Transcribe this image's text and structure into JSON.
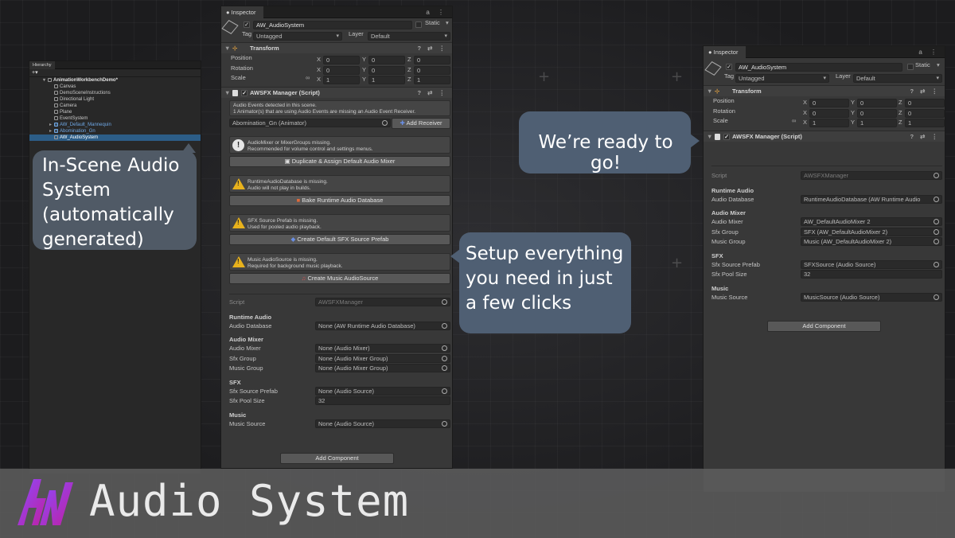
{
  "hierarchy": {
    "tab": "Hierarchy",
    "toolbar_add": "+▾",
    "items": [
      {
        "label": "AnimationWorkbenchDemo*",
        "indent": 0,
        "kind": "root"
      },
      {
        "label": "Canvas",
        "indent": 1,
        "kind": "normal"
      },
      {
        "label": "DemoSceneInstructions",
        "indent": 1,
        "kind": "normal"
      },
      {
        "label": "Directional Light",
        "indent": 1,
        "kind": "normal"
      },
      {
        "label": "Camera",
        "indent": 1,
        "kind": "normal"
      },
      {
        "label": "Plane",
        "indent": 1,
        "kind": "normal"
      },
      {
        "label": "EventSystem",
        "indent": 1,
        "kind": "normal"
      },
      {
        "label": "AW_Default_Mannequin",
        "indent": 1,
        "kind": "blue"
      },
      {
        "label": "Abomination_Gn",
        "indent": 1,
        "kind": "blue"
      },
      {
        "label": "AW_AudioSystem",
        "indent": 1,
        "kind": "selected"
      }
    ]
  },
  "left_inspector": {
    "tab": "Inspector",
    "object_name": "AW_AudioSystem",
    "static_label": "Static",
    "tag_label": "Tag",
    "tag_value": "Untagged",
    "layer_label": "Layer",
    "layer_value": "Default",
    "transform": {
      "title": "Transform",
      "position": {
        "label": "Position",
        "x": "0",
        "y": "0",
        "z": "0"
      },
      "rotation": {
        "label": "Rotation",
        "x": "0",
        "y": "0",
        "z": "0"
      },
      "scale": {
        "label": "Scale",
        "x": "1",
        "y": "1",
        "z": "1"
      }
    },
    "manager_title": "AWSFX Manager (Script)",
    "audio_events_msg": "Audio Events detected in this scene.\n1 Animator(s) that are using Audio Events are missing an Audio Event Receiver.",
    "animator_field": "Abomination_Gn (Animator)",
    "add_receiver_btn": "Add Receiver",
    "mixer_msg": "AudioMixer or MixerGroups missing.\nRecommended for volume control and settings menus.",
    "duplicate_btn": "Duplicate & Assign Default Audio Mixer",
    "runtime_msg": "RuntimeAudioDatabase is missing.\nAudio will not play in builds.",
    "bake_btn": "Bake Runtime Audio Database",
    "sfx_msg": "SFX Source Prefab is missing.\nUsed for pooled audio playback.",
    "create_sfx_btn": "Create Default SFX Source Prefab",
    "music_msg": "Music AudioSource is missing.\nRequired for background music playback.",
    "create_music_btn": "Create Music AudioSource",
    "script_label": "Script",
    "script_value": "AWSFXManager",
    "runtime_audio_header": "Runtime Audio",
    "audio_database_label": "Audio Database",
    "audio_database_value": "None (AW Runtime Audio Database)",
    "audio_mixer_header": "Audio Mixer",
    "audio_mixer_label": "Audio Mixer",
    "audio_mixer_value": "None (Audio Mixer)",
    "sfx_group_label": "Sfx Group",
    "sfx_group_value": "None (Audio Mixer Group)",
    "music_group_label": "Music Group",
    "music_group_value": "None (Audio Mixer Group)",
    "sfx_header": "SFX",
    "sfx_prefab_label": "Sfx Source Prefab",
    "sfx_prefab_value": "None (Audio Source)",
    "sfx_pool_label": "Sfx Pool Size",
    "sfx_pool_value": "32",
    "music_header": "Music",
    "music_source_label": "Music Source",
    "music_source_value": "None (Audio Source)",
    "add_component_btn": "Add Component"
  },
  "right_inspector": {
    "tab": "Inspector",
    "object_name": "AW_AudioSystem",
    "static_label": "Static",
    "tag_label": "Tag",
    "tag_value": "Untagged",
    "layer_label": "Layer",
    "layer_value": "Default",
    "transform": {
      "title": "Transform",
      "position": {
        "label": "Position",
        "x": "0",
        "y": "0",
        "z": "0"
      },
      "rotation": {
        "label": "Rotation",
        "x": "0",
        "y": "0",
        "z": "0"
      },
      "scale": {
        "label": "Scale",
        "x": "1",
        "y": "1",
        "z": "1"
      }
    },
    "manager_title": "AWSFX Manager (Script)",
    "script_label": "Script",
    "script_value": "AWSFXManager",
    "runtime_audio_header": "Runtime Audio",
    "audio_database_label": "Audio Database",
    "audio_database_value": "RuntimeAudioDatabase (AW Runtime Audio",
    "audio_mixer_header": "Audio Mixer",
    "audio_mixer_label": "Audio Mixer",
    "audio_mixer_value": "AW_DefaultAudioMixer 2",
    "sfx_group_label": "Sfx Group",
    "sfx_group_value": "SFX (AW_DefaultAudioMixer 2)",
    "music_group_label": "Music Group",
    "music_group_value": "Music (AW_DefaultAudioMixer 2)",
    "sfx_header": "SFX",
    "sfx_prefab_label": "Sfx Source Prefab",
    "sfx_prefab_value": "SFXSource (Audio Source)",
    "sfx_pool_label": "Sfx Pool Size",
    "sfx_pool_value": "32",
    "music_header": "Music",
    "music_source_label": "Music Source",
    "music_source_value": "MusicSource (Audio Source)",
    "add_component_btn": "Add Component"
  },
  "bubbles": {
    "in_scene": "In-Scene Audio System (automatically generated)",
    "setup": "Setup everything you need in just a few clicks",
    "ready": "We’re ready to go!"
  },
  "footer": {
    "logo_text": "AW",
    "title": "Audio System"
  },
  "colors": {
    "selection": "#2c5d87",
    "bubble": "#4f5f73",
    "warning": "#e8b21c",
    "logo_gradient_a": "#7b3fe4",
    "logo_gradient_b": "#c01fa0"
  }
}
